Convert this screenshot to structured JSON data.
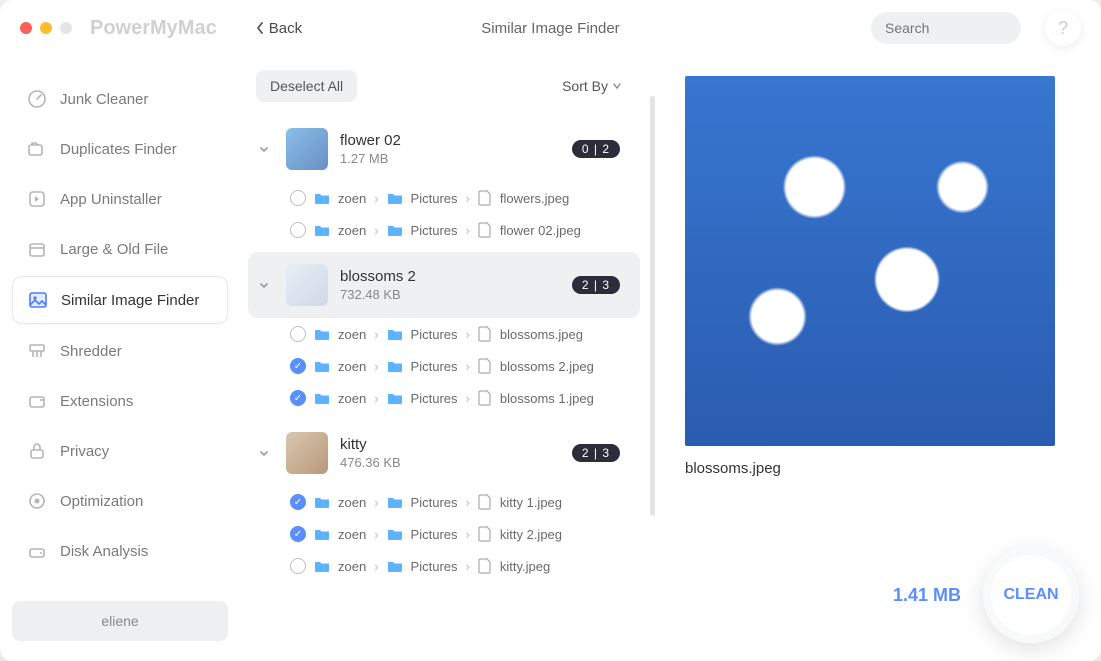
{
  "app_name": "PowerMyMac",
  "back_label": "Back",
  "page_title": "Similar Image Finder",
  "search_placeholder": "Search",
  "help_label": "?",
  "sidebar": {
    "items": [
      {
        "label": "Junk Cleaner",
        "icon": "gauge"
      },
      {
        "label": "Duplicates Finder",
        "icon": "folders"
      },
      {
        "label": "App Uninstaller",
        "icon": "app"
      },
      {
        "label": "Large & Old File",
        "icon": "archive"
      },
      {
        "label": "Similar Image Finder",
        "icon": "photo",
        "active": true
      },
      {
        "label": "Shredder",
        "icon": "shredder"
      },
      {
        "label": "Extensions",
        "icon": "ext"
      },
      {
        "label": "Privacy",
        "icon": "lock"
      },
      {
        "label": "Optimization",
        "icon": "opt"
      },
      {
        "label": "Disk Analysis",
        "icon": "disk"
      }
    ],
    "user": "eliene"
  },
  "toolbar": {
    "deselect_label": "Deselect All",
    "sort_label": "Sort By"
  },
  "groups": [
    {
      "title": "flower 02",
      "size": "1.27 MB",
      "badge": "0 | 2",
      "active": false,
      "thumb": "flower",
      "files": [
        {
          "checked": false,
          "path": [
            "zoen",
            "Pictures"
          ],
          "name": "flowers.jpeg"
        },
        {
          "checked": false,
          "path": [
            "zoen",
            "Pictures"
          ],
          "name": "flower 02.jpeg"
        }
      ]
    },
    {
      "title": "blossoms 2",
      "size": "732.48 KB",
      "badge": "2 | 3",
      "active": true,
      "thumb": "blossom",
      "files": [
        {
          "checked": false,
          "path": [
            "zoen",
            "Pictures"
          ],
          "name": "blossoms.jpeg"
        },
        {
          "checked": true,
          "path": [
            "zoen",
            "Pictures"
          ],
          "name": "blossoms 2.jpeg"
        },
        {
          "checked": true,
          "path": [
            "zoen",
            "Pictures"
          ],
          "name": "blossoms 1.jpeg"
        }
      ]
    },
    {
      "title": "kitty",
      "size": "476.36 KB",
      "badge": "2 | 3",
      "active": false,
      "thumb": "kitty",
      "files": [
        {
          "checked": true,
          "path": [
            "zoen",
            "Pictures"
          ],
          "name": "kitty 1.jpeg"
        },
        {
          "checked": true,
          "path": [
            "zoen",
            "Pictures"
          ],
          "name": "kitty 2.jpeg"
        },
        {
          "checked": false,
          "path": [
            "zoen",
            "Pictures"
          ],
          "name": "kitty.jpeg"
        }
      ]
    }
  ],
  "preview": {
    "filename": "blossoms.jpeg"
  },
  "footer": {
    "total_size": "1.41 MB",
    "clean_label": "CLEAN"
  }
}
